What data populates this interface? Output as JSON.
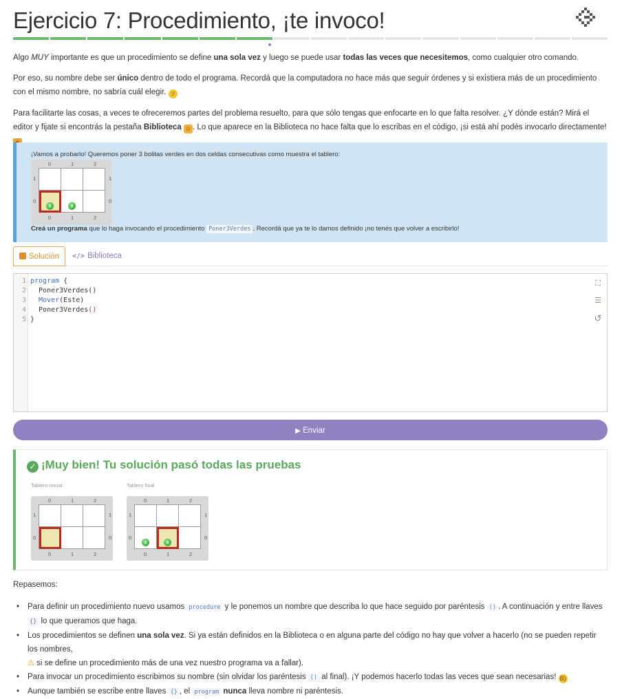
{
  "header": {
    "title": "Ejercicio 7: Procedimiento, ¡te invoco!",
    "progress_total": 16,
    "progress_done": 7
  },
  "intro": {
    "p1_a": "Algo ",
    "p1_b": "MUY",
    "p1_c": " importante es que un procedimiento se define ",
    "p1_d": "una sola vez",
    "p1_e": " y luego se puede usar ",
    "p1_f": "todas las veces que necesitemos",
    "p1_g": ", como cualquier otro comando.",
    "p2_a": "Por eso, su nombre debe ser ",
    "p2_b": "único",
    "p2_c": " dentro de todo el programa. Recordá que la computadora no hace más que seguir órdenes y si existiera más de un procedimiento con el mismo nombre, no sabría cuál elegir.",
    "p3_a": "Para facilitarte las cosas, a veces te ofreceremos partes del problema resuelto, para que sólo tengas que enfocarte en lo que falta resolver. ¿Y dónde están? Mirá el editor y fijate si encontrás la pestaña ",
    "p3_b": "Biblioteca",
    "p3_c": ". Lo que aparece en la Biblioteca no hace falta que lo escribas en el código, ¡si está ahí podés invocarlo directamente!"
  },
  "task": {
    "lead": "¡Vamos a probarlo! Queremos poner 3 bolitas verdes en dos celdas consecutivas como muestra el tablero:",
    "tail_a": "Creá un programa",
    "tail_b": " que lo haga invocando el procedimiento ",
    "tail_code": "Poner3Verdes",
    "tail_c": ". Recordá que ya te lo damos definido ¡no tenés que volver a escribirlo!",
    "board": {
      "cols": [
        "0",
        "1",
        "2"
      ],
      "rows": [
        "1",
        "0"
      ],
      "cursor": [
        0,
        0
      ],
      "balls": [
        {
          "x": 0,
          "y": 0,
          "count": "3"
        },
        {
          "x": 1,
          "y": 0,
          "count": "3"
        }
      ]
    }
  },
  "tabs": {
    "solution": "Solución",
    "library": "Biblioteca"
  },
  "editor": {
    "lines": [
      {
        "n": "1",
        "code": [
          {
            "t": "program",
            "c": "kw"
          },
          {
            "t": " {",
            "c": "fn"
          }
        ]
      },
      {
        "n": "2",
        "code": [
          {
            "t": "  Poner3Verdes()",
            "c": "fn"
          }
        ]
      },
      {
        "n": "3",
        "code": [
          {
            "t": "  ",
            "c": "fn"
          },
          {
            "t": "Mover",
            "c": "ty"
          },
          {
            "t": "(Este)",
            "c": "fn"
          }
        ]
      },
      {
        "n": "4",
        "code": [
          {
            "t": "  Poner3Verdes",
            "c": "fn"
          },
          {
            "t": "()",
            "c": "br"
          }
        ]
      },
      {
        "n": "5",
        "code": [
          {
            "t": "}",
            "c": "fn"
          }
        ]
      }
    ]
  },
  "submit": {
    "label": "Enviar"
  },
  "result": {
    "title": "¡Muy bien! Tu solución pasó todas las pruebas",
    "initial_caption": "Tablero inicial",
    "final_caption": "Tablero final",
    "initial_board": {
      "cols": [
        "0",
        "1",
        "2"
      ],
      "rows": [
        "1",
        "0"
      ],
      "cursor": [
        0,
        0
      ],
      "balls": []
    },
    "final_board": {
      "cols": [
        "0",
        "1",
        "2"
      ],
      "rows": [
        "1",
        "0"
      ],
      "cursor": [
        1,
        0
      ],
      "balls": [
        {
          "x": 0,
          "y": 0,
          "count": "3"
        },
        {
          "x": 1,
          "y": 0,
          "count": "3"
        }
      ]
    }
  },
  "recap": {
    "heading": "Repasemos:",
    "b1_a": "Para definir un procedimiento nuevo usamos ",
    "b1_code1": "procedure",
    "b1_b": " y le ponemos un nombre que describa lo que hace seguido por paréntesis ",
    "b1_code2": "()",
    "b1_c": ". A continuación y entre llaves ",
    "b1_code3": "{}",
    "b1_d": " lo que queramos que haga.",
    "b2_a": "Los procedimientos se definen ",
    "b2_b": "una sola vez",
    "b2_c": ". Si ya están definidos en la Biblioteca o en alguna parte del código no hay que volver a hacerlo (no se pueden repetir los nombres,",
    "b2_d": " si se define un procedimiento más de una vez nuestro programa va a fallar).",
    "b3_a": "Para invocar un procedimiento escribimos su nombre (sin olvidar los paréntesis ",
    "b3_code": "()",
    "b3_b": " al final). ¡Y podemos hacerlo todas las veces que sean necesarias!",
    "b4_a": "Aunque también se escribe entre llaves ",
    "b4_code1": "{}",
    "b4_b": ", el ",
    "b4_code2": "program",
    "b4_c": " nunca",
    "b4_d": " lleva nombre ni paréntesis."
  }
}
